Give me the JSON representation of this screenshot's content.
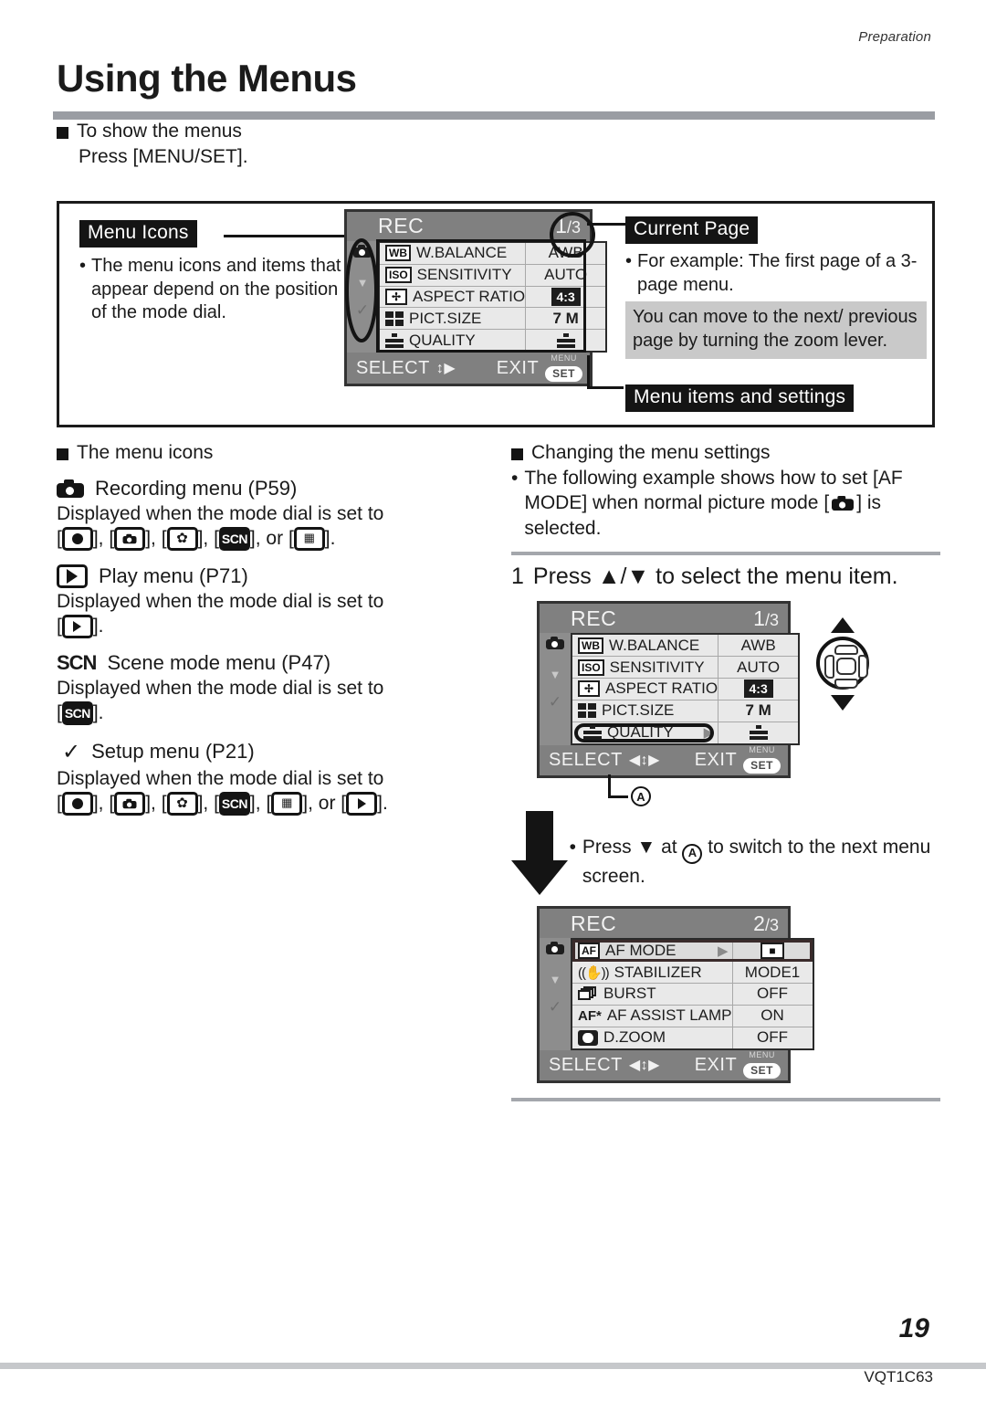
{
  "header": {
    "running_head": "Preparation",
    "title": "Using the Menus"
  },
  "section_show_menus": {
    "heading": "To show the menus",
    "instruction": "Press [MENU/SET]."
  },
  "diagram": {
    "callout_menu_icons": {
      "tag": "Menu Icons",
      "bullet": "•",
      "text": "The menu icons and items that appear depend on the position of the mode dial."
    },
    "callout_current_page": {
      "tag": "Current Page",
      "bullet": "•",
      "text": "For example: The first page of a 3-page menu.",
      "note": "You can move to the next/ previous page by turning the zoom lever."
    },
    "callout_menu_items": {
      "tag": "Menu items and settings"
    },
    "screen": {
      "title": "REC",
      "page": "1/3",
      "page_current": "1",
      "page_sep": "/",
      "page_total": "3",
      "rows": [
        {
          "icon": "wb-icon",
          "icon_text": "WB",
          "label": "W.BALANCE",
          "value": "AWB"
        },
        {
          "icon": "iso-icon",
          "icon_text": "ISO",
          "label": "SENSITIVITY",
          "value": "AUTO"
        },
        {
          "icon": "aspect-ratio-icon",
          "icon_text": "",
          "label": "ASPECT RATIO",
          "value": "4:3"
        },
        {
          "icon": "pict-size-icon",
          "icon_text": "",
          "label": "PICT.SIZE",
          "value": "7 M"
        },
        {
          "icon": "quality-icon",
          "icon_text": "",
          "label": "QUALITY",
          "value": ""
        }
      ],
      "footer_select": "SELECT",
      "footer_exit": "EXIT",
      "menu_set_top": "MENU",
      "menu_set_bottom": "SET"
    }
  },
  "section_menu_icons": {
    "heading": "The menu icons",
    "entries": [
      {
        "icon": "recording-camera-icon",
        "title": "Recording menu (P59)",
        "desc_lead": "Displayed when the mode dial is set to",
        "desc_tail_join": ", ",
        "desc_or": ", or ",
        "desc_end": ".",
        "dial_icons": [
          "record-dot-icon",
          "simple-camera-icon",
          "macro-flower-icon",
          "scn-icon",
          "motion-picture-icon"
        ]
      },
      {
        "icon": "play-icon",
        "title": "Play menu (P71)",
        "desc_lead": "Displayed when the mode dial is set to",
        "desc_end": ".",
        "dial_icons": [
          "play-icon"
        ]
      },
      {
        "icon": "scn-icon",
        "title": "Scene mode menu (P47)",
        "desc_lead": "Displayed when the mode dial is set to",
        "desc_end": ".",
        "dial_icons": [
          "scn-icon"
        ]
      },
      {
        "icon": "wrench-icon",
        "title": "Setup menu (P21)",
        "desc_lead": "Displayed when the mode dial is set to",
        "desc_end": ".",
        "dial_icons": [
          "record-dot-icon",
          "simple-camera-icon",
          "macro-flower-icon",
          "scn-icon",
          "motion-picture-icon",
          "play-icon"
        ]
      }
    ]
  },
  "section_changing": {
    "heading": "Changing the menu settings",
    "bullet": "•",
    "bullet_text_1": "The following example shows how to set [AF MODE] when normal picture mode",
    "bullet_text_2": "] is selected.",
    "step_number": "1",
    "step_text": "Press ▲/▼ to select the menu item.",
    "mid_bullet": "•",
    "mid_text_1": "Press",
    "mid_text_2": "at",
    "mid_text_3": "to switch to the next menu screen.",
    "callout_a": "A"
  },
  "screen_1_3": {
    "title": "REC",
    "page_current": "1",
    "page_sep": "/",
    "page_total": "3",
    "rows": [
      {
        "icon": "wb-icon",
        "icon_text": "WB",
        "label": "W.BALANCE",
        "value": "AWB"
      },
      {
        "icon": "iso-icon",
        "icon_text": "ISO",
        "label": "SENSITIVITY",
        "value": "AUTO"
      },
      {
        "icon": "aspect-ratio-icon",
        "icon_text": "",
        "label": "ASPECT RATIO",
        "value": "4:3"
      },
      {
        "icon": "pict-size-icon",
        "icon_text": "",
        "label": "PICT.SIZE",
        "value": "7 M"
      },
      {
        "icon": "quality-icon",
        "icon_text": "",
        "label": "QUALITY",
        "value": ""
      }
    ],
    "selected_row": "QUALITY",
    "footer_select": "SELECT",
    "footer_exit": "EXIT",
    "menu_set_top": "MENU",
    "menu_set_bottom": "SET"
  },
  "screen_2_3": {
    "title": "REC",
    "page_current": "2",
    "page_sep": "/",
    "page_total": "3",
    "rows": [
      {
        "icon": "af-icon",
        "icon_text": "AF",
        "label": "AF MODE",
        "value": ""
      },
      {
        "icon": "stabilizer-icon",
        "icon_text": "",
        "label": "STABILIZER",
        "value": "MODE1"
      },
      {
        "icon": "burst-icon",
        "icon_text": "",
        "label": "BURST",
        "value": "OFF"
      },
      {
        "icon": "af-assist-icon",
        "icon_text": "AF*",
        "label": "AF ASSIST LAMP",
        "value": "ON"
      },
      {
        "icon": "d-zoom-icon",
        "icon_text": "",
        "label": "D.ZOOM",
        "value": "OFF"
      }
    ],
    "selected_row": "AF MODE",
    "footer_select": "SELECT",
    "footer_exit": "EXIT",
    "menu_set_top": "MENU",
    "menu_set_bottom": "SET"
  },
  "footer": {
    "page_number": "19",
    "doc_id": "VQT1C63"
  },
  "colors": {
    "rule": "#9a9da3",
    "lcd_bg": "#808080",
    "lcd_rows": "#e9e9e9",
    "tag_bg": "#141414",
    "note_bg": "#c9c9c9"
  }
}
